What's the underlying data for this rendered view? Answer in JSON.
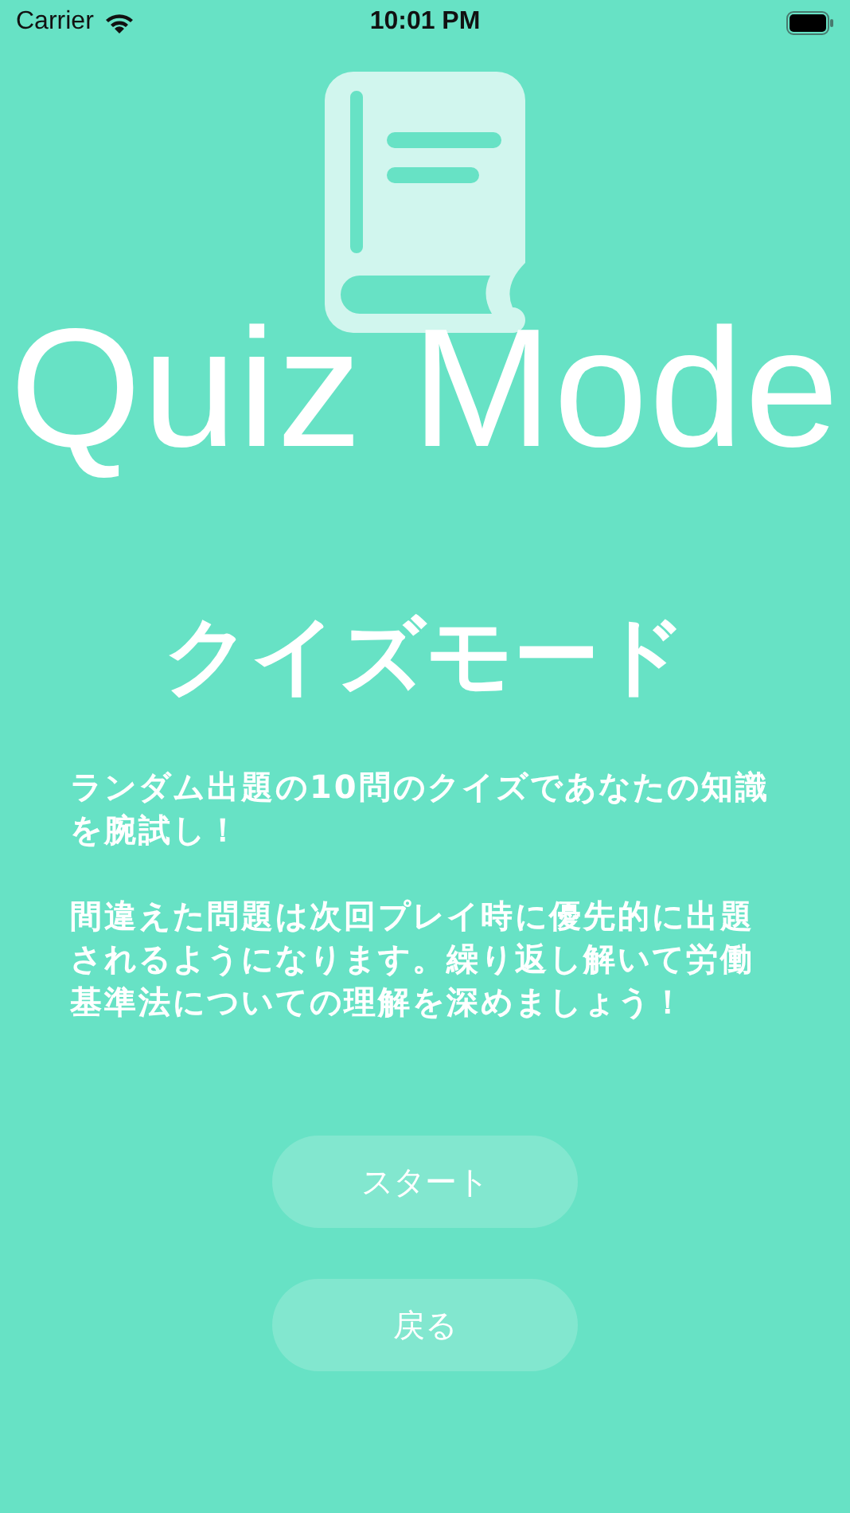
{
  "status_bar": {
    "carrier": "Carrier",
    "time": "10:01 PM"
  },
  "title": "Quiz Mode",
  "heading": "クイズモード",
  "description": [
    "ランダム出題の10問のクイズであなたの知識を腕試し！",
    "間違えた問題は次回プレイ時に優先的に出題されるようになります。繰り返し解いて労働基準法についての理解を深めましょう！"
  ],
  "buttons": [
    "スタート",
    "戻る"
  ]
}
